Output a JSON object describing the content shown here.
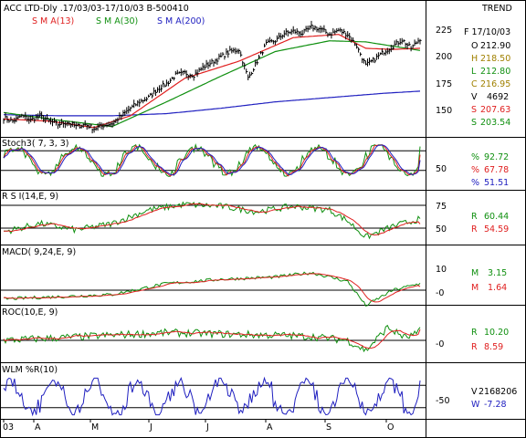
{
  "header": {
    "title": "ACC LTD-Dly .17/03/03-17/10/03  B-500410",
    "trend": "TREND",
    "sma_labels": [
      {
        "text": "S M A(13)",
        "color": "#e02020"
      },
      {
        "text": "S M A(30)",
        "color": "#109010"
      },
      {
        "text": "S M A(200)",
        "color": "#2020c0"
      }
    ]
  },
  "info": {
    "date": "F 17/10/03",
    "values": [
      {
        "label": "O",
        "value": "212.90",
        "color": "#000000"
      },
      {
        "label": "H",
        "value": "218.50",
        "color": "#a08000"
      },
      {
        "label": "L",
        "value": "212.80",
        "color": "#109010"
      },
      {
        "label": "C",
        "value": "216.95",
        "color": "#a08000"
      },
      {
        "label": "V",
        "value": "4692",
        "color": "#000000"
      },
      {
        "label": "S",
        "value": "207.63",
        "color": "#e02020"
      },
      {
        "label": "S",
        "value": "203.54",
        "color": "#109010"
      }
    ]
  },
  "x_axis": {
    "labels": [
      "03",
      "A",
      "M",
      "J",
      "J",
      "A",
      "S",
      "O"
    ]
  },
  "panels": [
    {
      "name": "price",
      "label": "",
      "ticks": [
        "225",
        "200",
        "175",
        "150"
      ],
      "values": []
    },
    {
      "name": "stoch",
      "label": "Stoch3( 7, 3, 3)",
      "ticks": [
        "50"
      ],
      "values": [
        {
          "label": "%",
          "value": "92.72",
          "color": "#109010"
        },
        {
          "label": "%",
          "value": "67.78",
          "color": "#e02020"
        },
        {
          "label": "%",
          "value": "51.51",
          "color": "#2020c0"
        }
      ]
    },
    {
      "name": "rsi",
      "label": "R S I(14,E, 9)",
      "ticks": [
        "75",
        "50"
      ],
      "values": [
        {
          "label": "R",
          "value": "60.44",
          "color": "#109010"
        },
        {
          "label": "R",
          "value": "54.59",
          "color": "#e02020"
        }
      ]
    },
    {
      "name": "macd",
      "label": "MACD( 9,24,E, 9)",
      "ticks": [
        "10",
        "-0"
      ],
      "values": [
        {
          "label": "M",
          "value": "3.15",
          "color": "#109010"
        },
        {
          "label": "M",
          "value": "1.64",
          "color": "#e02020"
        }
      ]
    },
    {
      "name": "roc",
      "label": "ROC(10,E, 9)",
      "ticks": [
        "-0"
      ],
      "values": [
        {
          "label": "R",
          "value": "10.20",
          "color": "#109010"
        },
        {
          "label": "R",
          "value": "8.59",
          "color": "#e02020"
        }
      ]
    },
    {
      "name": "wlm",
      "label": "WLM %R(10)",
      "ticks": [
        "-50"
      ],
      "values": [
        {
          "label": "V",
          "value": "2168206",
          "color": "#000000"
        },
        {
          "label": "W",
          "value": "-7.28",
          "color": "#2020c0"
        }
      ]
    }
  ],
  "chart_data": {
    "type": "line",
    "title": "ACC LTD-Dly .17/03/03-17/10/03  B-500410",
    "x_months": [
      "03",
      "A",
      "M",
      "J",
      "J",
      "A",
      "S",
      "O"
    ],
    "price": {
      "ylim": [
        125,
        235
      ],
      "close_anchors": [
        [
          0,
          143
        ],
        [
          5,
          140
        ],
        [
          10,
          145
        ],
        [
          15,
          141
        ],
        [
          20,
          145
        ],
        [
          25,
          140
        ],
        [
          30,
          137
        ],
        [
          35,
          139
        ],
        [
          40,
          135
        ],
        [
          45,
          137
        ],
        [
          50,
          133
        ],
        [
          55,
          136
        ],
        [
          60,
          138
        ],
        [
          65,
          145
        ],
        [
          70,
          152
        ],
        [
          75,
          158
        ],
        [
          80,
          162
        ],
        [
          85,
          170
        ],
        [
          90,
          175
        ],
        [
          95,
          183
        ],
        [
          100,
          185
        ],
        [
          105,
          183
        ],
        [
          110,
          190
        ],
        [
          115,
          195
        ],
        [
          120,
          200
        ],
        [
          125,
          205
        ],
        [
          130,
          207
        ],
        [
          135,
          180
        ],
        [
          140,
          196
        ],
        [
          145,
          212
        ],
        [
          150,
          215
        ],
        [
          155,
          222
        ],
        [
          160,
          224
        ],
        [
          165,
          222
        ],
        [
          170,
          228
        ],
        [
          175,
          226
        ],
        [
          180,
          221
        ],
        [
          185,
          225
        ],
        [
          190,
          221
        ],
        [
          195,
          210
        ],
        [
          200,
          192
        ],
        [
          205,
          198
        ],
        [
          210,
          205
        ],
        [
          215,
          210
        ],
        [
          220,
          216
        ],
        [
          225,
          208
        ],
        [
          230,
          217
        ]
      ],
      "sma13_anchors": [
        [
          0,
          142
        ],
        [
          25,
          140
        ],
        [
          50,
          134
        ],
        [
          70,
          145
        ],
        [
          100,
          180
        ],
        [
          130,
          196
        ],
        [
          160,
          218
        ],
        [
          185,
          221
        ],
        [
          200,
          208
        ],
        [
          215,
          207
        ],
        [
          230,
          208
        ]
      ],
      "sma30_anchors": [
        [
          0,
          148
        ],
        [
          30,
          141
        ],
        [
          60,
          135
        ],
        [
          90,
          158
        ],
        [
          120,
          182
        ],
        [
          150,
          205
        ],
        [
          180,
          215
        ],
        [
          200,
          214
        ],
        [
          215,
          210
        ],
        [
          230,
          206
        ]
      ],
      "sma200_anchors": [
        [
          0,
          146
        ],
        [
          30,
          145
        ],
        [
          60,
          145
        ],
        [
          90,
          147
        ],
        [
          120,
          152
        ],
        [
          150,
          158
        ],
        [
          180,
          162
        ],
        [
          210,
          166
        ],
        [
          230,
          168
        ]
      ]
    },
    "stoch": {
      "ylim": [
        0,
        100
      ],
      "levels": [
        80,
        20
      ],
      "k": 92.72,
      "d": 67.78,
      "slow": 51.51
    },
    "rsi": {
      "ylim": [
        30,
        85
      ],
      "levels": [
        75,
        50
      ],
      "rsi": 60.44,
      "signal": 54.59,
      "anchors": [
        [
          0,
          46
        ],
        [
          20,
          55
        ],
        [
          40,
          48
        ],
        [
          60,
          55
        ],
        [
          80,
          70
        ],
        [
          100,
          76
        ],
        [
          120,
          74
        ],
        [
          140,
          68
        ],
        [
          160,
          74
        ],
        [
          180,
          70
        ],
        [
          190,
          58
        ],
        [
          200,
          40
        ],
        [
          215,
          52
        ],
        [
          230,
          60
        ]
      ]
    },
    "macd": {
      "ylim": [
        -15,
        15
      ],
      "levels": [
        0
      ],
      "macd": 3.15,
      "signal": 1.64,
      "anchors": [
        [
          0,
          -4
        ],
        [
          30,
          -3
        ],
        [
          60,
          -2
        ],
        [
          90,
          3
        ],
        [
          120,
          5
        ],
        [
          150,
          6
        ],
        [
          170,
          8
        ],
        [
          190,
          4
        ],
        [
          200,
          -7
        ],
        [
          215,
          0
        ],
        [
          230,
          3
        ]
      ]
    },
    "roc": {
      "ylim": [
        -15,
        15
      ],
      "levels": [
        0
      ],
      "roc": 10.2,
      "signal": 8.59,
      "anchors": [
        [
          0,
          0
        ],
        [
          30,
          2
        ],
        [
          60,
          4
        ],
        [
          90,
          6
        ],
        [
          120,
          5
        ],
        [
          150,
          4
        ],
        [
          170,
          3
        ],
        [
          190,
          0
        ],
        [
          200,
          -8
        ],
        [
          212,
          10
        ],
        [
          222,
          2
        ],
        [
          230,
          6
        ]
      ]
    },
    "wlm": {
      "ylim": [
        -100,
        0
      ],
      "levels": [
        -20,
        -80
      ],
      "value": -7.28,
      "volume": 2168206
    }
  }
}
